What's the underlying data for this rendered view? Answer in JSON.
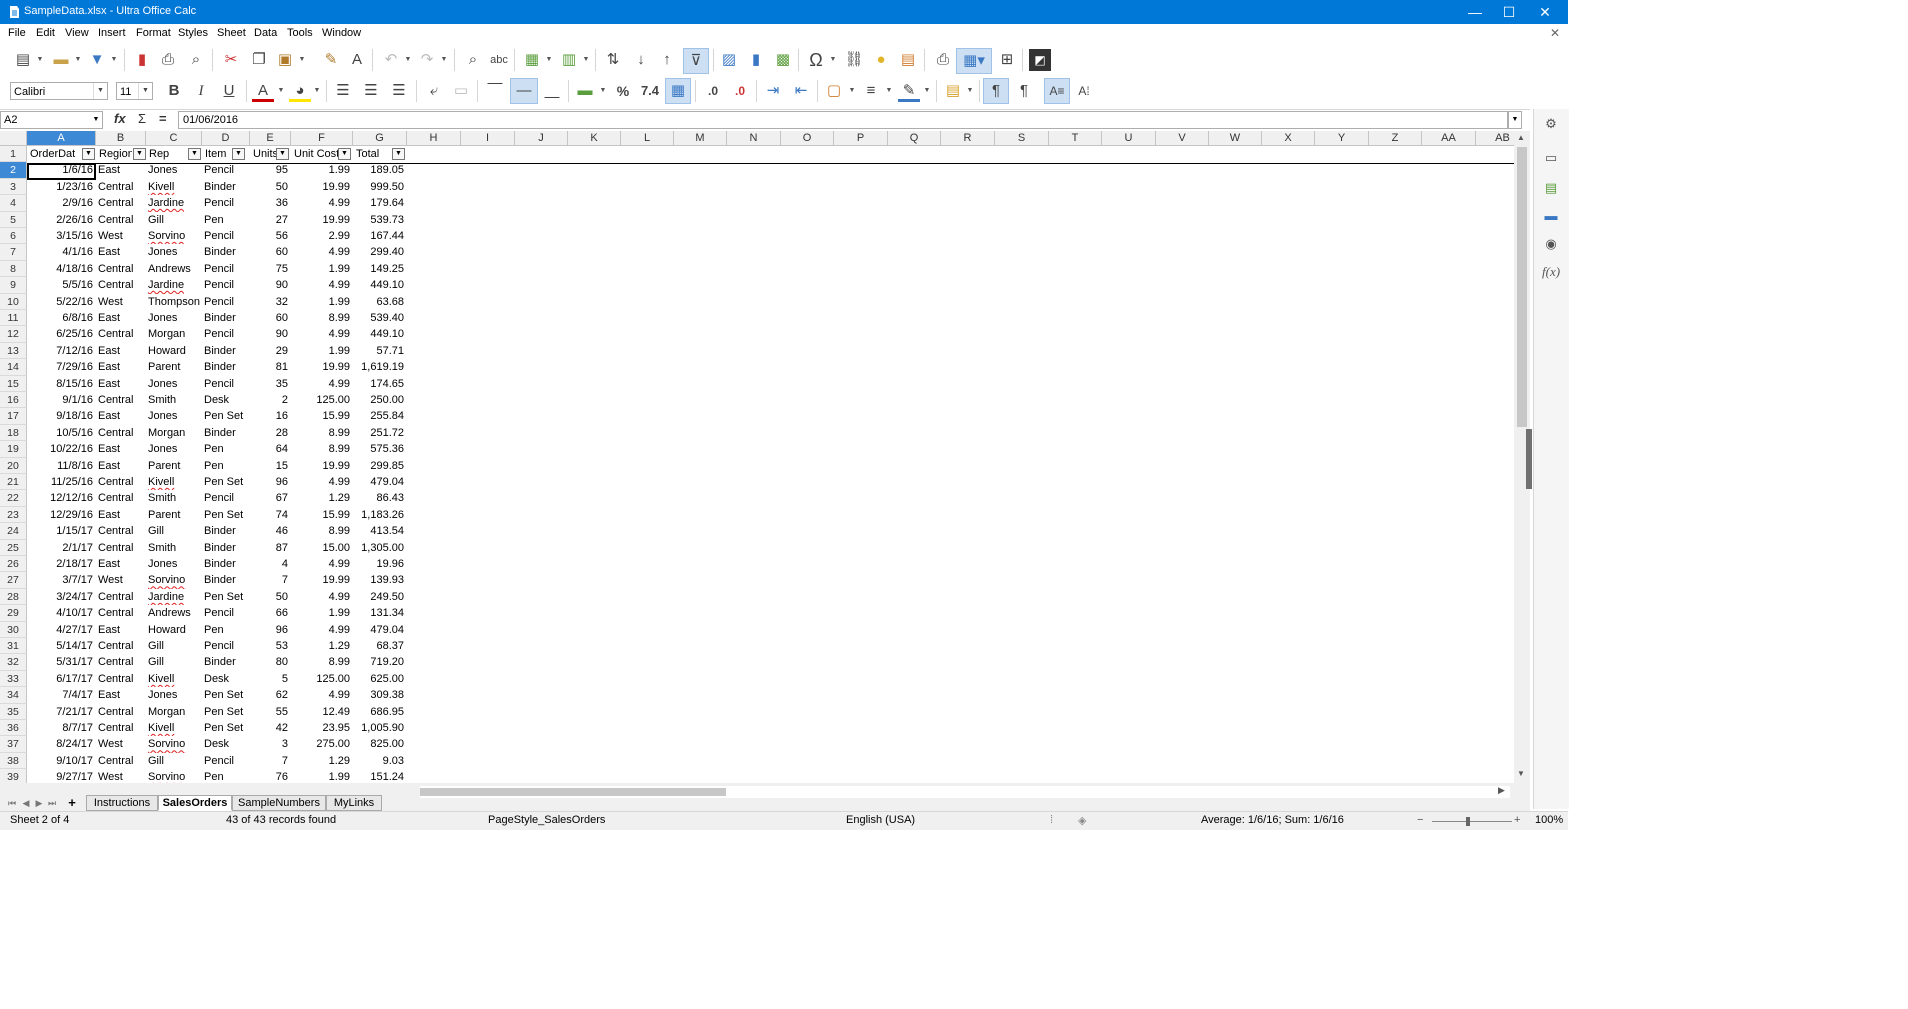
{
  "window": {
    "title": "SampleData.xlsx - Ultra Office Calc",
    "minimize": "—",
    "maximize": "☐",
    "close": "✕",
    "doc_close": "✕"
  },
  "menu": [
    "File",
    "Edit",
    "View",
    "Insert",
    "Format",
    "Styles",
    "Sheet",
    "Data",
    "Tools",
    "Window"
  ],
  "toolbar2": {
    "font_name": "Calibri",
    "font_size": "11",
    "percent": "%",
    "number": "7.4"
  },
  "formula": {
    "cell_ref": "A2",
    "fx": "fx",
    "sum": "Σ",
    "equals": "=",
    "content": "01/06/2016"
  },
  "columns": [
    "A",
    "B",
    "C",
    "D",
    "E",
    "F",
    "G",
    "H",
    "I",
    "J",
    "K",
    "L",
    "M",
    "N",
    "O",
    "P",
    "Q",
    "R",
    "S",
    "T",
    "U",
    "V",
    "W",
    "X",
    "Y",
    "Z",
    "AA",
    "AB"
  ],
  "headers": [
    "OrderDat",
    "Region",
    "Rep",
    "Item",
    "Units",
    "Unit Cost",
    "Total"
  ],
  "rows": [
    [
      "1/6/16",
      "East",
      "Jones",
      "Pencil",
      "95",
      "1.99",
      "189.05"
    ],
    [
      "1/23/16",
      "Central",
      "Kivell",
      "Binder",
      "50",
      "19.99",
      "999.50"
    ],
    [
      "2/9/16",
      "Central",
      "Jardine",
      "Pencil",
      "36",
      "4.99",
      "179.64"
    ],
    [
      "2/26/16",
      "Central",
      "Gill",
      "Pen",
      "27",
      "19.99",
      "539.73"
    ],
    [
      "3/15/16",
      "West",
      "Sorvino",
      "Pencil",
      "56",
      "2.99",
      "167.44"
    ],
    [
      "4/1/16",
      "East",
      "Jones",
      "Binder",
      "60",
      "4.99",
      "299.40"
    ],
    [
      "4/18/16",
      "Central",
      "Andrews",
      "Pencil",
      "75",
      "1.99",
      "149.25"
    ],
    [
      "5/5/16",
      "Central",
      "Jardine",
      "Pencil",
      "90",
      "4.99",
      "449.10"
    ],
    [
      "5/22/16",
      "West",
      "Thompson",
      "Pencil",
      "32",
      "1.99",
      "63.68"
    ],
    [
      "6/8/16",
      "East",
      "Jones",
      "Binder",
      "60",
      "8.99",
      "539.40"
    ],
    [
      "6/25/16",
      "Central",
      "Morgan",
      "Pencil",
      "90",
      "4.99",
      "449.10"
    ],
    [
      "7/12/16",
      "East",
      "Howard",
      "Binder",
      "29",
      "1.99",
      "57.71"
    ],
    [
      "7/29/16",
      "East",
      "Parent",
      "Binder",
      "81",
      "19.99",
      "1,619.19"
    ],
    [
      "8/15/16",
      "East",
      "Jones",
      "Pencil",
      "35",
      "4.99",
      "174.65"
    ],
    [
      "9/1/16",
      "Central",
      "Smith",
      "Desk",
      "2",
      "125.00",
      "250.00"
    ],
    [
      "9/18/16",
      "East",
      "Jones",
      "Pen Set",
      "16",
      "15.99",
      "255.84"
    ],
    [
      "10/5/16",
      "Central",
      "Morgan",
      "Binder",
      "28",
      "8.99",
      "251.72"
    ],
    [
      "10/22/16",
      "East",
      "Jones",
      "Pen",
      "64",
      "8.99",
      "575.36"
    ],
    [
      "11/8/16",
      "East",
      "Parent",
      "Pen",
      "15",
      "19.99",
      "299.85"
    ],
    [
      "11/25/16",
      "Central",
      "Kivell",
      "Pen Set",
      "96",
      "4.99",
      "479.04"
    ],
    [
      "12/12/16",
      "Central",
      "Smith",
      "Pencil",
      "67",
      "1.29",
      "86.43"
    ],
    [
      "12/29/16",
      "East",
      "Parent",
      "Pen Set",
      "74",
      "15.99",
      "1,183.26"
    ],
    [
      "1/15/17",
      "Central",
      "Gill",
      "Binder",
      "46",
      "8.99",
      "413.54"
    ],
    [
      "2/1/17",
      "Central",
      "Smith",
      "Binder",
      "87",
      "15.00",
      "1,305.00"
    ],
    [
      "2/18/17",
      "East",
      "Jones",
      "Binder",
      "4",
      "4.99",
      "19.96"
    ],
    [
      "3/7/17",
      "West",
      "Sorvino",
      "Binder",
      "7",
      "19.99",
      "139.93"
    ],
    [
      "3/24/17",
      "Central",
      "Jardine",
      "Pen Set",
      "50",
      "4.99",
      "249.50"
    ],
    [
      "4/10/17",
      "Central",
      "Andrews",
      "Pencil",
      "66",
      "1.99",
      "131.34"
    ],
    [
      "4/27/17",
      "East",
      "Howard",
      "Pen",
      "96",
      "4.99",
      "479.04"
    ],
    [
      "5/14/17",
      "Central",
      "Gill",
      "Pencil",
      "53",
      "1.29",
      "68.37"
    ],
    [
      "5/31/17",
      "Central",
      "Gill",
      "Binder",
      "80",
      "8.99",
      "719.20"
    ],
    [
      "6/17/17",
      "Central",
      "Kivell",
      "Desk",
      "5",
      "125.00",
      "625.00"
    ],
    [
      "7/4/17",
      "East",
      "Jones",
      "Pen Set",
      "62",
      "4.99",
      "309.38"
    ],
    [
      "7/21/17",
      "Central",
      "Morgan",
      "Pen Set",
      "55",
      "12.49",
      "686.95"
    ],
    [
      "8/7/17",
      "Central",
      "Kivell",
      "Pen Set",
      "42",
      "23.95",
      "1,005.90"
    ],
    [
      "8/24/17",
      "West",
      "Sorvino",
      "Desk",
      "3",
      "275.00",
      "825.00"
    ],
    [
      "9/10/17",
      "Central",
      "Gill",
      "Pencil",
      "7",
      "1.29",
      "9.03"
    ],
    [
      "9/27/17",
      "West",
      "Sorvino",
      "Pen",
      "76",
      "1.99",
      "151.24"
    ]
  ],
  "spellcheck_names": [
    "Kivell",
    "Jardine",
    "Sorvino"
  ],
  "sheet_tabs": [
    "Instructions",
    "SalesOrders",
    "SampleNumbers",
    "MyLinks"
  ],
  "active_sheet": "SalesOrders",
  "add_sheet": "+",
  "status": {
    "sheet": "Sheet 2 of 4",
    "records": "43 of 43 records found",
    "page_style": "PageStyle_SalesOrders",
    "language": "English (USA)",
    "selection_stats": "Average: 1/6/16; Sum: 1/6/16",
    "zoom_minus": "−",
    "zoom_plus": "+",
    "zoom": "100%"
  },
  "colors": {
    "titlebar": "#0078d7",
    "selection": "#3e89d5",
    "spellcheck": "#e02020"
  }
}
